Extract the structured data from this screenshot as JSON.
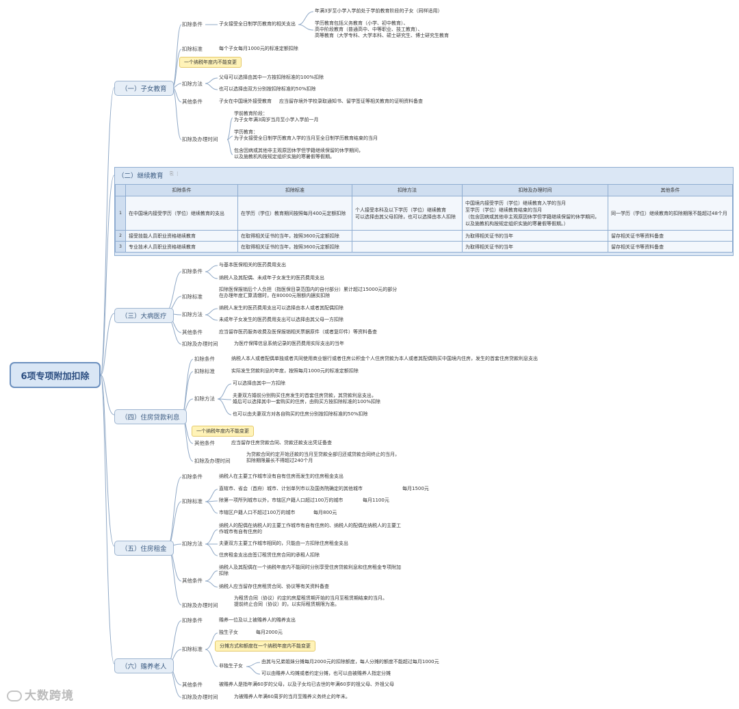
{
  "root": "6项专项附加扣除",
  "s1": {
    "title": "（一）子女教育",
    "cat_cond": "扣除条件",
    "cond": "子女接受全日制学历教育的相关支出",
    "cond_a": "年满3岁至小学入学前处于学前教育阶段的子女（同样适用）",
    "cond_b": "学历教育包括义务教育（小学、初中教育）、\n高中阶段教育（普通高中、中等职业、技工教育）、\n高等教育（大学专科、大学本科、硕士研究生、博士研究生教育",
    "cat_std": "扣除标准",
    "std": "每个子女每月1000元的标准定额扣除",
    "note": "一个纳税年度内不能变更",
    "cat_method": "扣除方法",
    "method_a": "父母可以选择由其中一方按扣除标准的100%扣除",
    "method_b": "也可以选择由双方分别按扣除标准的50%扣除",
    "cat_other": "其他条件",
    "other": "子女在中国境外接受教育",
    "other_b": "应当留存境外学校录取通知书、留学签证等相关教育的证明资料备查",
    "cat_time": "扣除及办理时间",
    "time_a": "学前教育阶段：\n为子女年满3周岁当月至小学入学前一月",
    "time_b": "学历教育：\n为子女接受全日制学历教育入学的当月至全日制学历教育结束的当月",
    "time_c": "包含因病或其他非主观原因休学但学籍继续保留的休学期间，\n以及施教机构按规定组织实施的寒暑假等假期。"
  },
  "s2": {
    "title": "（二）继续教育",
    "icons": "⎘ ⋮",
    "headers": [
      "扣除条件",
      "扣除标准",
      "扣除方法",
      "扣除及办理时间",
      "其他条件"
    ],
    "rows": [
      [
        "1",
        "在中国境内接受学历（学位）继续教育的支出",
        "在学历（学位）教育期间按照每月400元定额扣除",
        "个人接受本科及以下学历（学位）继续教育\n可以选择由其父母扣除，也可以选择由本人扣除",
        "中国境内接受学历（学位）继续教育入学的当月\n至学历（学位）继续教育结束的当月\n（包含因病或其他非主观原因休学但学籍继续保留的休学期间，\n以及施教机构按规定组织实施的寒暑假等假期。）",
        "同一学历（学位）继续教育的扣除期限不能超过48个月"
      ],
      [
        "2",
        "接受技能人员职业资格继续教育",
        "在取得相关证书的当年，按照3600元定额扣除",
        "",
        "为取得相关证书的当年",
        "留存相关证书等资料备查"
      ],
      [
        "3",
        "专业技术人员职业资格继续教育",
        "在取得相关证书的当年，按照3600元定额扣除",
        "",
        "为取得相关证书的当年",
        "留存相关证书等资料备查"
      ]
    ]
  },
  "s3": {
    "title": "（三）大病医疗",
    "cat_cond": "扣除条件",
    "cond_a": "与基本医保相关的医药费用支出",
    "cond_b": "纳税人及其配偶、未成年子女发生的医药费用支出",
    "cat_std": "扣除标准",
    "std": "扣除医保报销后个人负担（指医保目录范围内的自付部分）累计超过15000元的部分\n在办理年度汇算清缴时，在80000元限额内据实扣除",
    "cat_method": "扣除方法",
    "method_a": "纳税人发生的医药费用支出可以选择由本人或者其配偶扣除",
    "method_b": "未成年子女发生的医药费用支出可以选择由其父母一方扣除",
    "cat_other": "其他条件",
    "other": "应当留存医药服务收费及医保报销相关票据原件（或者复印件）等资料备查",
    "cat_time": "扣除及办理时间",
    "time": "为医疗保障信息系统记录的医药费用实际支出的当年"
  },
  "s4": {
    "title": "（四）住房贷款利息",
    "cat_cond": "扣除条件",
    "cond": "纳税人本人或者配偶单独或者共同使用商业银行或者住房公积金个人住房贷款为本人或者其配偶购买中国境内住房，发生的首套住房贷款利息支出",
    "cat_std": "扣除标准",
    "std": "实际发生贷款利息的年度，按照每月1000元的标准定额扣除",
    "cat_method": "扣除方法",
    "method_a": "可以选择由其中一方扣除",
    "method_b": "夫妻双方婚前分别购买住房发生的首套住房贷款，其贷款利息支出，\n婚后可以选择其中一套购买的住房，由购买方按扣除标准的100%扣除",
    "method_c": "也可以由夫妻双方对各自购买的住房分别按扣除标准的50%扣除",
    "note": "一个纳税年度内不能变更",
    "cat_other": "其他条件",
    "other": "应当留存住房贷款合同、贷款还款支出凭证备查",
    "cat_time": "扣除及办理时间",
    "time": "为贷款合同约定开始还款的当月至贷款全部归还或贷款合同终止的当月，\n扣除期限最长不得超过240个月"
  },
  "s5": {
    "title": "（五）住房租金",
    "cat_cond": "扣除条件",
    "cond": "纳税人在主要工作城市没有自有住房而发生的住房租金支出",
    "cat_std": "扣除标准",
    "std_a": "直辖市、省会（首府）城市、计划单列市以及国务院确定的其他城市",
    "std_a_v": "每月1500元",
    "std_b": "除第一项所列城市以外，市辖区户籍人口超过100万的城市",
    "std_b_v": "每月1100元",
    "std_c": "市辖区户籍人口不超过100万的城市",
    "std_c_v": "每月800元",
    "cat_method": "扣除方法",
    "method_a": "纳税人的配偶在纳税人的主要工作城市有自有住房的、纳税人的配偶在纳税人的主要工\n作城市有自有住房的",
    "method_b": "夫妻双方主要工作城市相同的，只能由一方扣除住房租金支出",
    "method_c": "住房租金支出由签订租赁住房合同的承租人扣除",
    "cat_other": "其他条件",
    "other_a": "纳税人及其配偶在一个纳税年度内不能同时分别享受住房贷款利息和住房租金专项附加\n扣除",
    "other_b": "纳税人应当留存住房租赁合同、协议等有关资料备查",
    "cat_time": "扣除及办理时间",
    "time": "为租赁合同（协议）约定的房屋租赁期开始的当月至租赁期结束的当月。\n提前终止合同（协议）的，以实际租赁期限为准。"
  },
  "s6": {
    "title": "（六）赡养老人",
    "cat_cond": "扣除条件",
    "cond": "赡养一位及以上被赡养人的赡养支出",
    "cat_std": "扣除标准",
    "only": "独生子女",
    "only_v": "每月2000元",
    "note": "分摊方式和额度在一个纳税年度内不能变更",
    "not_only": "非独生子女",
    "not_only_a": "由其与兄弟姐妹分摊每月2000元的扣除额度，每人分摊的额度不能超过每月1000元",
    "not_only_b": "可以由赡养人均摊或者约定分摊，也可以由被赡养人指定分摊",
    "cat_other": "其他条件",
    "other": "被赡养人是指年满60岁的父母，以及子女均已去世的年满60岁的祖父母、外祖父母",
    "cat_time": "扣除及办理时间",
    "time": "为被赡养人年满60周岁的当月至赡养义务终止的年末。"
  },
  "watermark": "大数跨境"
}
